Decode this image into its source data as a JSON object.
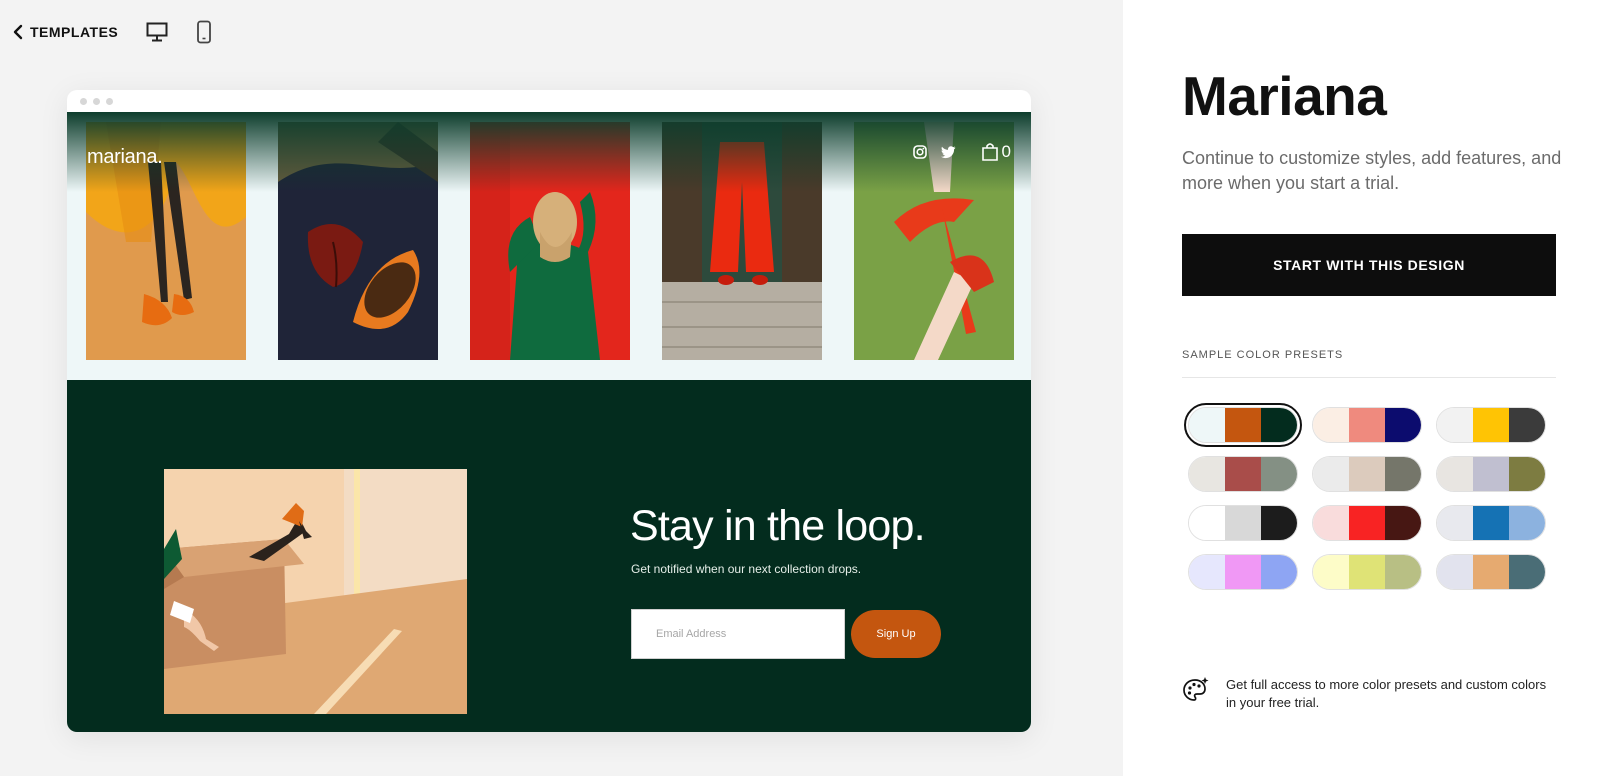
{
  "topbar": {
    "back_label": "TEMPLATES",
    "icons": [
      "chevron-left-icon",
      "desktop-icon",
      "mobile-icon"
    ]
  },
  "preview": {
    "site_logo": "mariana.",
    "cart_count": "0",
    "header_icons": [
      "instagram-icon",
      "twitter-icon",
      "shopping-bag-icon"
    ],
    "newsletter": {
      "title": "Stay in the loop.",
      "subtitle": "Get notified when our next collection drops.",
      "email_placeholder": "Email Address",
      "signup_label": "Sign Up"
    }
  },
  "panel": {
    "title": "Mariana",
    "description": "Continue to customize styles, add features, and more when you start a trial.",
    "start_button": "START WITH THIS DESIGN",
    "presets_label": "SAMPLE COLOR PRESETS",
    "presets": [
      {
        "colors": [
          "#eef7f8",
          "#c4560f",
          "#032c1e"
        ],
        "selected": true
      },
      {
        "colors": [
          "#fbeee4",
          "#ef8a7e",
          "#0c0c6e"
        ],
        "selected": false
      },
      {
        "colors": [
          "#f2f2f2",
          "#ffc404",
          "#3b3b3b"
        ],
        "selected": false
      },
      {
        "colors": [
          "#e8e6e1",
          "#a94d4a",
          "#849084"
        ],
        "selected": false
      },
      {
        "colors": [
          "#ebebeb",
          "#dccbbd",
          "#75766a"
        ],
        "selected": false
      },
      {
        "colors": [
          "#e8e5e1",
          "#c0bfd0",
          "#7d7c41"
        ],
        "selected": false
      },
      {
        "colors": [
          "#ffffff",
          "#d8d8d8",
          "#1c1c1c"
        ],
        "selected": false
      },
      {
        "colors": [
          "#f9dcdc",
          "#f82323",
          "#471713"
        ],
        "selected": false
      },
      {
        "colors": [
          "#e8e9ee",
          "#1572b4",
          "#8cb2df"
        ],
        "selected": false
      },
      {
        "colors": [
          "#e6e7fd",
          "#f098f5",
          "#8ea5f3"
        ],
        "selected": false
      },
      {
        "colors": [
          "#fdfcc8",
          "#dfe376",
          "#b8bf84"
        ],
        "selected": false
      },
      {
        "colors": [
          "#e2e3ee",
          "#e6aa70",
          "#4a6d76"
        ],
        "selected": false
      }
    ],
    "access_text": "Get full access to more color presets and custom colors in your free trial."
  }
}
